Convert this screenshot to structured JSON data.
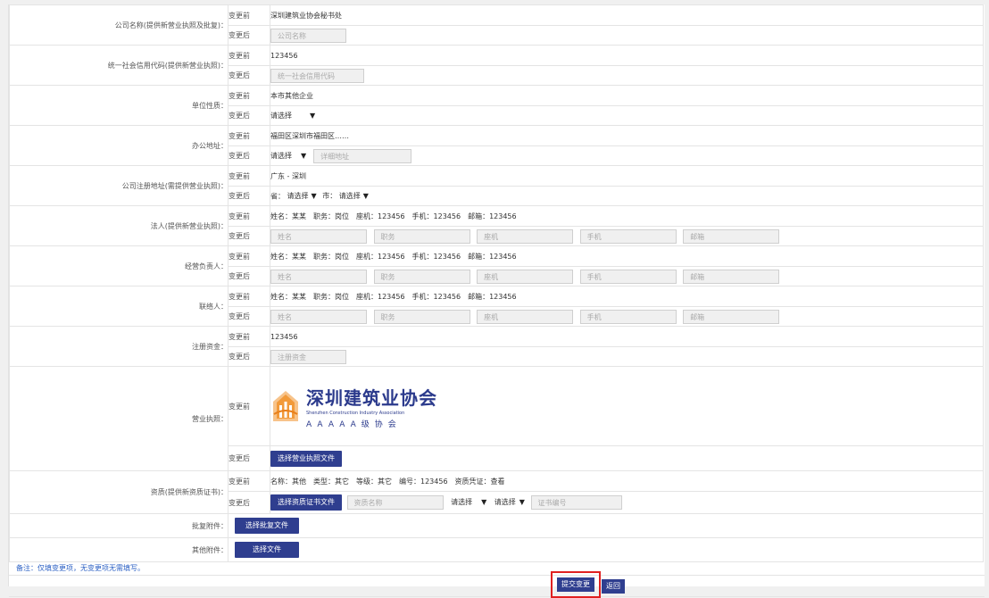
{
  "labels": {
    "before": "变更前",
    "after": "变更后"
  },
  "rows": {
    "company_name": {
      "label": "公司名称(提供新营业执照及批复)：",
      "before": "深圳建筑业协会秘书处",
      "placeholder": "公司名称"
    },
    "credit_code": {
      "label": "统一社会信用代码(提供新营业执照)：",
      "before": "123456",
      "placeholder": "统一社会信用代码"
    },
    "unit_nature": {
      "label": "单位性质：",
      "before": "本市其他企业",
      "select": "请选择"
    },
    "office_address": {
      "label": "办公地址：",
      "before": "福田区深圳市福田区……",
      "select": "请选择",
      "placeholder": "详细地址"
    },
    "reg_address": {
      "label": "公司注册地址(需提供营业执照)：",
      "before": "广东 - 深圳",
      "province_label": "省：",
      "province_select": "请选择",
      "city_label": "市：",
      "city_select": "请选择"
    },
    "legal_person": {
      "label": "法人(提供新营业执照)：",
      "before": "姓名：某某　职务：岗位　座机：123456　手机：123456　邮箱：123456"
    },
    "manager": {
      "label": "经营负责人：",
      "before": "姓名：某某　职务：岗位　座机：123456　手机：123456　邮箱：123456"
    },
    "contact": {
      "label": "联络人：",
      "before": "姓名：某某　职务：岗位　座机：123456　手机：123456　邮箱：123456"
    },
    "reg_capital": {
      "label": "注册资金：",
      "before": "123456",
      "placeholder": "注册资金"
    },
    "license": {
      "label": "营业执照：",
      "button": "选择营业执照文件"
    },
    "qualification": {
      "label": "资质(提供新资质证书)：",
      "before": "名称：其他　类型：其它　等级：其它　编号：123456　资质凭证：查看",
      "button": "选择资质证书文件",
      "placeholder_name": "资质名称",
      "select1": "请选择",
      "select2": "请选择",
      "placeholder_no": "证书编号"
    },
    "approval": {
      "label": "批复附件：",
      "button": "选择批复文件"
    },
    "other": {
      "label": "其他附件：",
      "button": "选择文件"
    }
  },
  "person_fields": {
    "name": "姓名",
    "title": "职务",
    "phone": "座机",
    "mobile": "手机",
    "email": "邮箱"
  },
  "logo": {
    "cn": "深圳建筑业协会",
    "en": "Shenzhen Construction Industry Association",
    "grade": "AAAAA级协会"
  },
  "note": "备注：仅填变更项，无变更项无需填写。",
  "actions": {
    "submit": "提交变更",
    "back": "返回"
  },
  "colors": {
    "button": "#2f3e8f",
    "note": "#2e62c5",
    "highlight": "#e02020"
  }
}
